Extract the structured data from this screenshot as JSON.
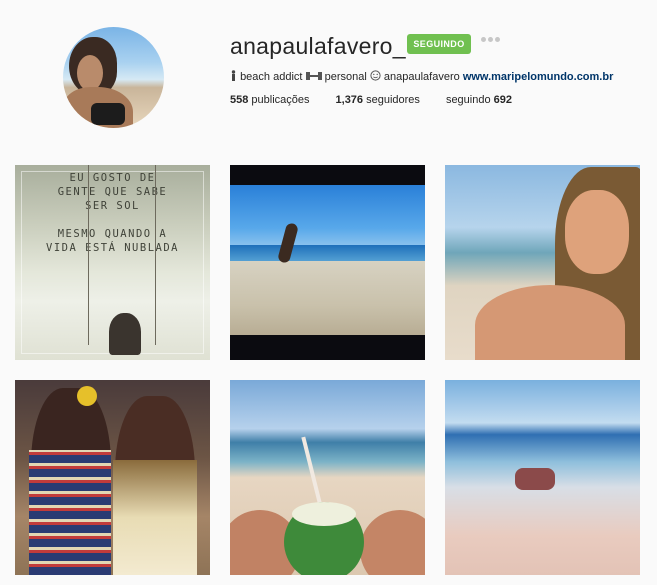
{
  "profile": {
    "username": "anapaulafavero_",
    "follow_button": "SEGUINDO",
    "bio": {
      "part1": "beach addict",
      "part2": "personal",
      "part3": "anapaulafavero",
      "link": "www.maripelomundo.com.br"
    },
    "stats": {
      "posts_count": "558",
      "posts_label": "publicações",
      "followers_count": "1,376",
      "followers_label": "seguidores",
      "following_label": "seguindo",
      "following_count": "692"
    }
  },
  "posts": {
    "quote_text": "EU GOSTO DE\nGENTE QUE SABE\nSER SOL\n\nMESMO QUANDO A\nVIDA ESTÁ NUBLADA"
  },
  "colors": {
    "follow_green": "#70c050",
    "link_blue": "#003569"
  }
}
